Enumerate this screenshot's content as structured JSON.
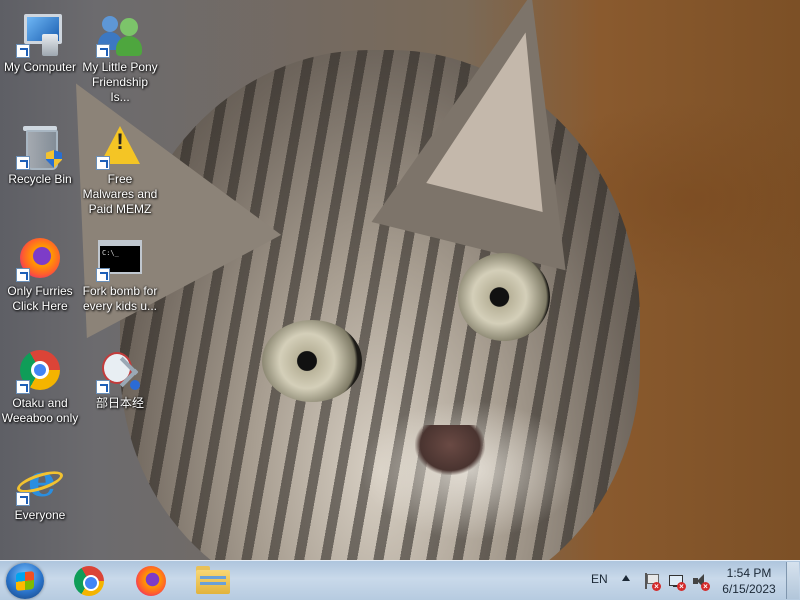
{
  "desktop": {
    "icons": [
      {
        "label": "My Computer",
        "icon": "computer-icon"
      },
      {
        "label": "My Little Pony Friendship Is...",
        "icon": "users-icon"
      },
      {
        "label": "Recycle Bin",
        "icon": "recycle-bin-icon"
      },
      {
        "label": "Free Malwares and Paid MEMZ",
        "icon": "warning-icon"
      },
      {
        "label": "Only Furries Click Here",
        "icon": "firefox-icon"
      },
      {
        "label": "Fork bomb for every kids u...",
        "icon": "command-prompt-icon"
      },
      {
        "label": "Otaku and Weeaboo only",
        "icon": "chrome-icon"
      },
      {
        "label": "部日本经",
        "icon": "snipping-tool-icon"
      },
      {
        "label": "Everyone",
        "icon": "internet-explorer-icon"
      }
    ],
    "cmd_prompt_text": "C:\\_"
  },
  "taskbar": {
    "pinned": [
      {
        "name": "Google Chrome",
        "icon": "chrome-icon"
      },
      {
        "name": "Mozilla Firefox",
        "icon": "firefox-icon"
      },
      {
        "name": "Windows Explorer",
        "icon": "folder-icon"
      }
    ],
    "language": "EN",
    "tray_icons": [
      "action-center-flag-icon",
      "network-icon",
      "volume-icon"
    ],
    "time": "1:54 PM",
    "date": "6/15/2023"
  }
}
